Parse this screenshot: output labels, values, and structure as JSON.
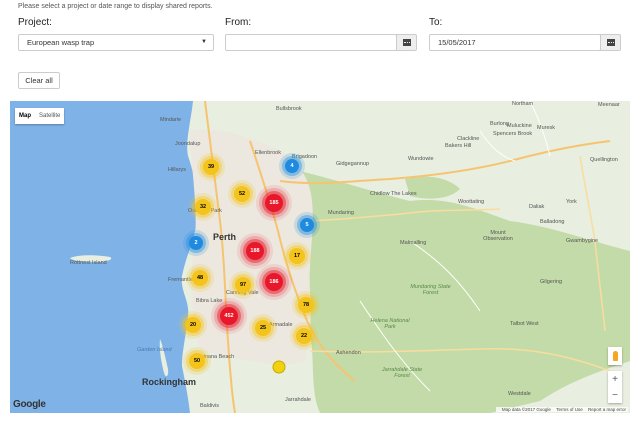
{
  "instructions": "Please select a project or date range to display shared reports.",
  "filters": {
    "project_label": "Project:",
    "project_value": "European wasp trap",
    "from_label": "From:",
    "from_value": "",
    "to_label": "To:",
    "to_value": "15/05/2017",
    "clear_label": "Clear all"
  },
  "map": {
    "type_map": "Map",
    "type_satellite": "Satellite",
    "zoom_in": "+",
    "zoom_out": "−",
    "logo": "Google",
    "attribution": {
      "data": "Map data ©2017 Google",
      "terms": "Terms of Use",
      "report": "Report a map error"
    },
    "places": {
      "bullsbrook": "Bullsbrook",
      "mindarie": "Mindarie",
      "joondalup": "Joondalup",
      "hillarys": "Hillarys",
      "osborne_park": "Osborne Park",
      "perth": "Perth",
      "rottnest": "Rottnest Island",
      "fremantle": "Fremantle",
      "bibra_lake": "Bibra Lake",
      "canning_vale": "Canning Vale",
      "armadale": "Armadale",
      "garden_island": "Garden Island",
      "kwinana": "Kwinana Beach",
      "rockingham": "Rockingham",
      "baldivis": "Baldivis",
      "jarrahdale": "Jarrahdale",
      "ellenbrook": "Ellenbrook",
      "brigadoon": "Brigadoon",
      "gidgegannup": "Gidgegannup",
      "mundaring": "Mundaring",
      "chidlow": "Chidlow The Lakes",
      "wooroloo": "Wooroloo",
      "wundowie": "Wundowie",
      "bakers_hill": "Bakers Hill",
      "clackline": "Clackline",
      "northam": "Northam",
      "meenaar": "Meenaar",
      "burlong": "Burlong",
      "muluckine": "Muluckine",
      "muresk": "Muresk",
      "spencers_brook": "Spencers Brook",
      "quellington": "Quellington",
      "york": "York",
      "daliak": "Daliak",
      "balladong": "Balladong",
      "gwambygine": "Gwambygine",
      "woottating": "Woottating",
      "malmalling": "Malmalling",
      "mount_observation": "Mount Observation",
      "gilgering": "Gilgering",
      "talbot_west": "Talbot West",
      "ashendon": "Ashendon",
      "westdale": "Westdale",
      "mundaring_forest": "Mundaring State Forest",
      "helena_park": "Helena National Park",
      "jarrahdale_forest": "Jarrahdale State Forest"
    },
    "clusters": [
      {
        "label": "39",
        "color": "yellow"
      },
      {
        "label": "52",
        "color": "yellow"
      },
      {
        "label": "32",
        "color": "yellow"
      },
      {
        "label": "4",
        "color": "blue"
      },
      {
        "label": "185",
        "color": "red"
      },
      {
        "label": "5",
        "color": "blue"
      },
      {
        "label": "2",
        "color": "blue"
      },
      {
        "label": "188",
        "color": "red"
      },
      {
        "label": "17",
        "color": "yellow"
      },
      {
        "label": "48",
        "color": "yellow"
      },
      {
        "label": "97",
        "color": "yellow"
      },
      {
        "label": "186",
        "color": "red"
      },
      {
        "label": "78",
        "color": "yellow"
      },
      {
        "label": "452",
        "color": "red"
      },
      {
        "label": "20",
        "color": "yellow"
      },
      {
        "label": "25",
        "color": "yellow"
      },
      {
        "label": "22",
        "color": "yellow"
      },
      {
        "label": "50",
        "color": "yellow"
      }
    ]
  },
  "colors": {
    "cluster_red": "#e8172a",
    "cluster_yellow": "#f4c41a",
    "cluster_blue": "#1f8be0",
    "ocean": "#7fb3e8",
    "land": "#e8eee0",
    "forest": "#c3dba8"
  }
}
